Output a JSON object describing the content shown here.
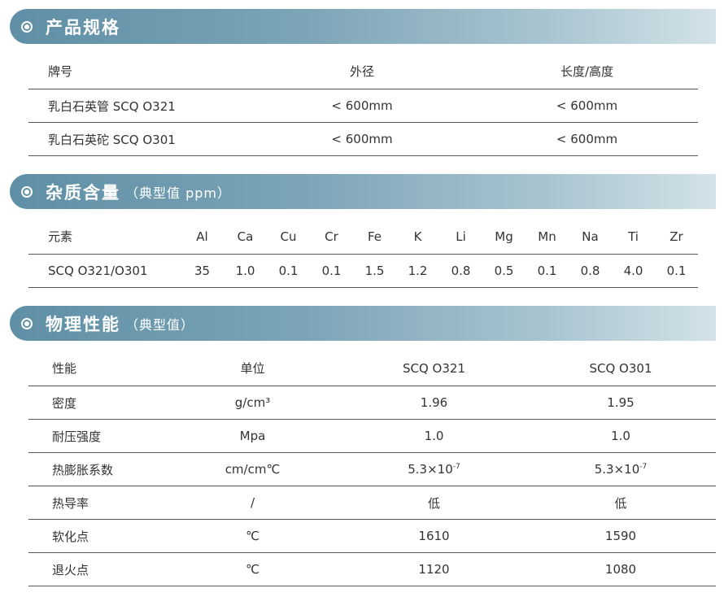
{
  "section1": {
    "title": "产品规格",
    "headers": [
      "牌号",
      "外径",
      "长度/高度"
    ],
    "rows": [
      [
        "乳白石英管 SCQ O321",
        "< 600mm",
        "< 600mm"
      ],
      [
        "乳白石英砣 SCQ O301",
        "< 600mm",
        "< 600mm"
      ]
    ]
  },
  "section2": {
    "title": "杂质含量",
    "subtitle": "（典型值 ppm）",
    "headers": [
      "元素",
      "Al",
      "Ca",
      "Cu",
      "Cr",
      "Fe",
      "K",
      "Li",
      "Mg",
      "Mn",
      "Na",
      "Ti",
      "Zr"
    ],
    "row": [
      "SCQ O321/O301",
      "35",
      "1.0",
      "0.1",
      "0.1",
      "1.5",
      "1.2",
      "0.8",
      "0.5",
      "0.1",
      "0.8",
      "4.0",
      "0.1"
    ]
  },
  "section3": {
    "title": "物理性能",
    "subtitle": "（典型值）",
    "headers": [
      "性能",
      "单位",
      "SCQ O321",
      "SCQ O301"
    ],
    "rows": [
      [
        "密度",
        "g/cm³",
        "1.96",
        "1.95"
      ],
      [
        "耐压强度",
        "Mpa",
        "1.0",
        "1.0"
      ],
      [
        "热膨胀系数",
        "cm/cm℃",
        "5.3×10",
        "5.3×10"
      ],
      [
        "热导率",
        "/",
        "低",
        "低"
      ],
      [
        "软化点",
        "℃",
        "1610",
        "1590"
      ],
      [
        "退火点",
        "℃",
        "1120",
        "1080"
      ]
    ],
    "exponent": "-7"
  }
}
